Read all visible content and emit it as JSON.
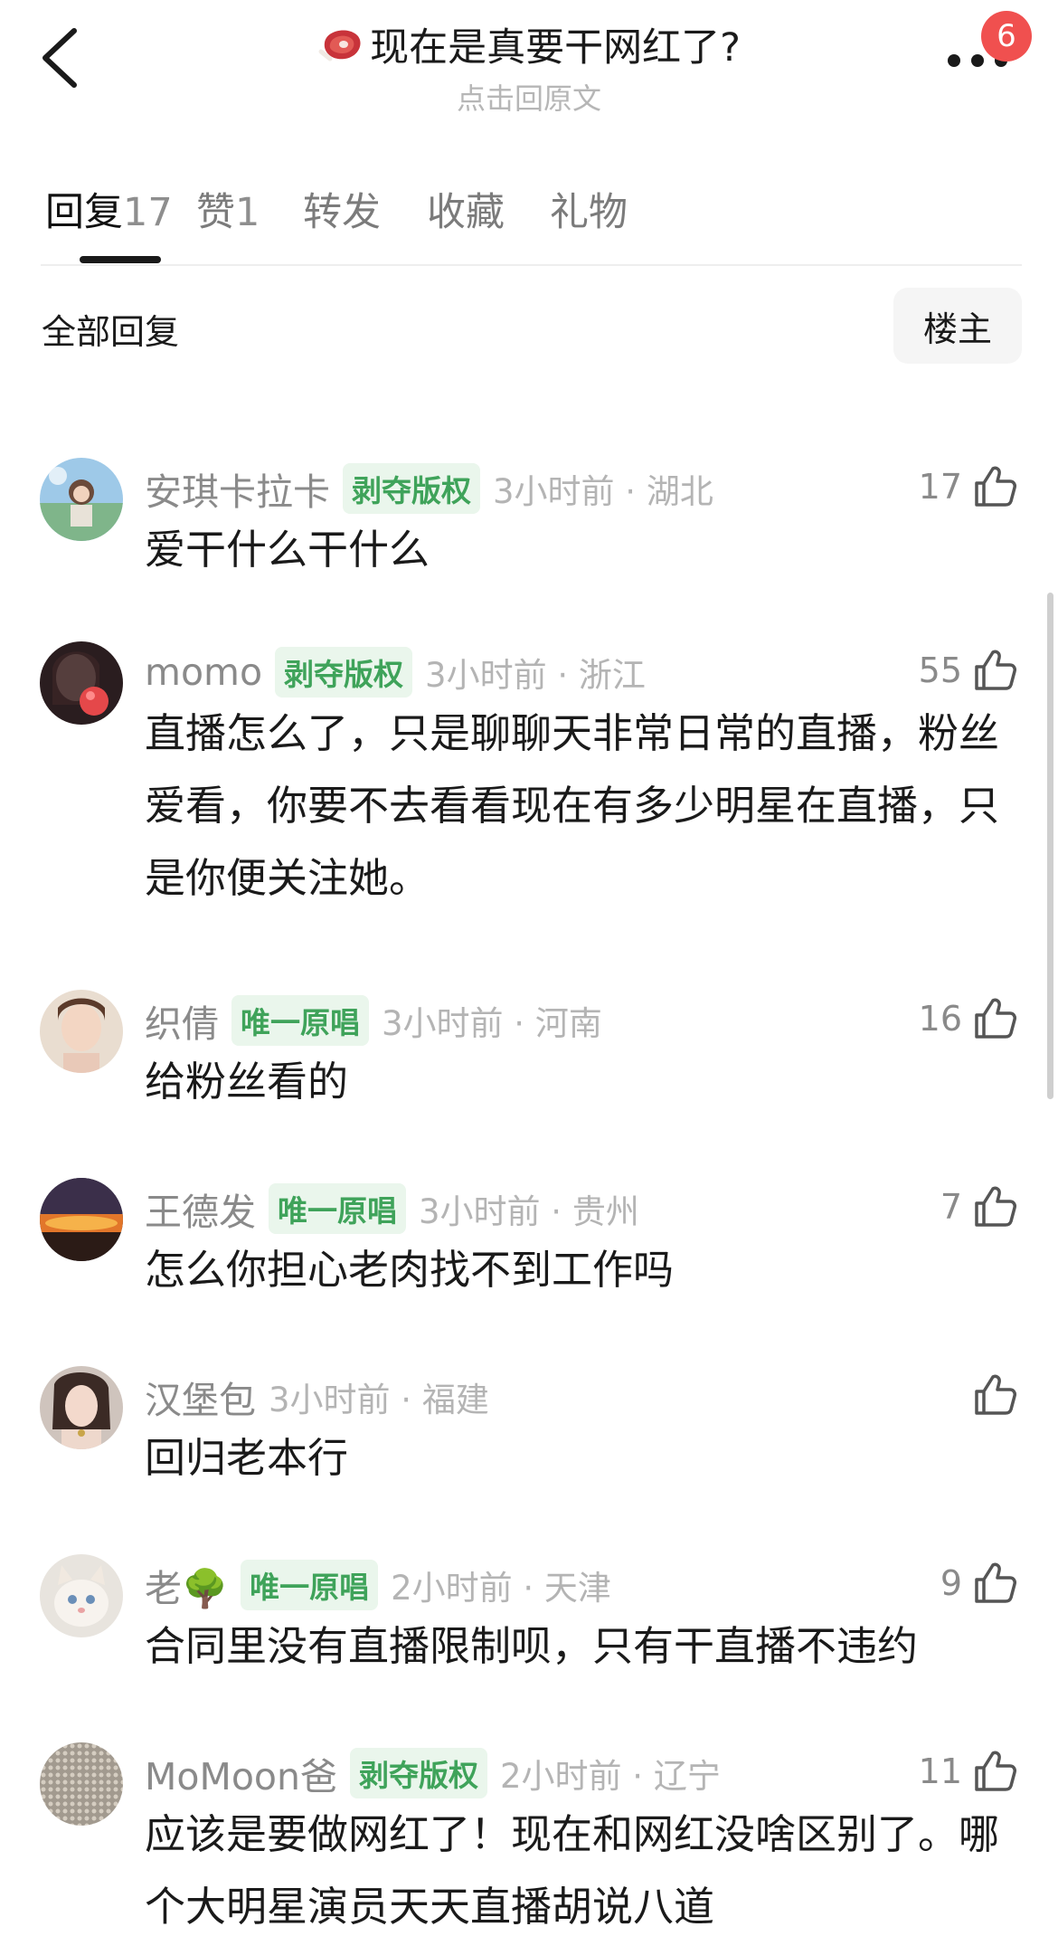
{
  "header": {
    "title": "现在是真要干网红了?",
    "subtitle": "点击回原文",
    "notification_count": "6"
  },
  "tabs": [
    {
      "label": "回复",
      "count": "17"
    },
    {
      "label": "赞",
      "count": "1"
    },
    {
      "label": "转发",
      "count": ""
    },
    {
      "label": "收藏",
      "count": ""
    },
    {
      "label": "礼物",
      "count": ""
    }
  ],
  "filter": {
    "label": "全部回复",
    "button": "楼主"
  },
  "comments": [
    {
      "name": "安琪卡拉卡",
      "tag": "剥夺版权",
      "time": "3小时前 · 湖北",
      "likes": "17",
      "text": "爱干什么干什么"
    },
    {
      "name": "momo",
      "tag": "剥夺版权",
      "time": "3小时前 · 浙江",
      "likes": "55",
      "text": "直播怎么了，只是聊聊天非常日常的直播，粉丝爱看，你要不去看看现在有多少明星在直播，只是你便关注她。"
    },
    {
      "name": "织倩",
      "tag": "唯一原唱",
      "time": "3小时前 · 河南",
      "likes": "16",
      "text": "给粉丝看的"
    },
    {
      "name": "王德发",
      "tag": "唯一原唱",
      "time": "3小时前 · 贵州",
      "likes": "7",
      "text": "怎么你担心老肉找不到工作吗"
    },
    {
      "name": "汉堡包",
      "tag": "",
      "time": "3小时前 · 福建",
      "likes": "",
      "text": "回归老本行"
    },
    {
      "name": "老🌳",
      "tag": "唯一原唱",
      "time": "2小时前 · 天津",
      "likes": "9",
      "text": "合同里没有直播限制呗，只有干直播不违约"
    },
    {
      "name": "MoMoon爸",
      "tag": "剥夺版权",
      "time": "2小时前 · 辽宁",
      "likes": "11",
      "text": "应该是要做网红了！现在和网红没啥区别了。哪个大明星演员天天直播胡说八道"
    }
  ],
  "colors": {
    "tag_bg": "#eaf6ec",
    "tag_text": "#3fa35a",
    "badge": "#f0504f"
  }
}
